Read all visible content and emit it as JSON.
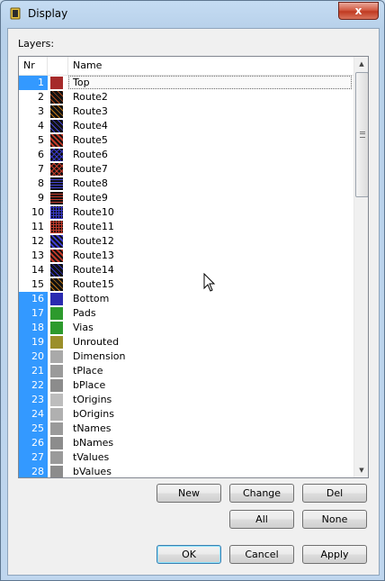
{
  "window": {
    "title": "Display",
    "close_glyph": "x"
  },
  "layers_label": "Layers:",
  "columns": {
    "nr": "Nr",
    "name": "Name"
  },
  "rows": [
    {
      "nr": "1",
      "name": "Top",
      "selected": false,
      "color": "#a62b2b",
      "pattern": "solid"
    },
    {
      "nr": "2",
      "name": "Route2",
      "selected": false,
      "color": "#b04a1b",
      "pattern": "diag-dark"
    },
    {
      "nr": "3",
      "name": "Route3",
      "selected": false,
      "color": "#c07818",
      "pattern": "diag-dark"
    },
    {
      "nr": "4",
      "name": "Route4",
      "selected": false,
      "color": "#4848d8",
      "pattern": "diag-dark"
    },
    {
      "nr": "5",
      "name": "Route5",
      "selected": false,
      "color": "#c23a2a",
      "pattern": "diag-dense"
    },
    {
      "nr": "6",
      "name": "Route6",
      "selected": false,
      "color": "#3838c8",
      "pattern": "cross"
    },
    {
      "nr": "7",
      "name": "Route7",
      "selected": false,
      "color": "#c23a2a",
      "pattern": "cross"
    },
    {
      "nr": "8",
      "name": "Route8",
      "selected": false,
      "color": "#4646d8",
      "pattern": "horiz"
    },
    {
      "nr": "9",
      "name": "Route9",
      "selected": false,
      "color": "#c23a2a",
      "pattern": "horiz"
    },
    {
      "nr": "10",
      "name": "Route10",
      "selected": false,
      "color": "#3838c8",
      "pattern": "grid"
    },
    {
      "nr": "11",
      "name": "Route11",
      "selected": false,
      "color": "#c23a2a",
      "pattern": "grid"
    },
    {
      "nr": "12",
      "name": "Route12",
      "selected": false,
      "color": "#3e3ed0",
      "pattern": "diag-dense"
    },
    {
      "nr": "13",
      "name": "Route13",
      "selected": false,
      "color": "#c23a2a",
      "pattern": "diag-dense"
    },
    {
      "nr": "14",
      "name": "Route14",
      "selected": false,
      "color": "#3838c8",
      "pattern": "diag-dark"
    },
    {
      "nr": "15",
      "name": "Route15",
      "selected": false,
      "color": "#c07818",
      "pattern": "diag-dark"
    },
    {
      "nr": "16",
      "name": "Bottom",
      "selected": true,
      "color": "#2b2bb0",
      "pattern": "solid"
    },
    {
      "nr": "17",
      "name": "Pads",
      "selected": true,
      "color": "#2d9a2d",
      "pattern": "solid"
    },
    {
      "nr": "18",
      "name": "Vias",
      "selected": true,
      "color": "#2d9a2d",
      "pattern": "solid"
    },
    {
      "nr": "19",
      "name": "Unrouted",
      "selected": true,
      "color": "#9b8f2a",
      "pattern": "solid"
    },
    {
      "nr": "20",
      "name": "Dimension",
      "selected": true,
      "color": "#a9a9a9",
      "pattern": "solid"
    },
    {
      "nr": "21",
      "name": "tPlace",
      "selected": true,
      "color": "#9a9a9a",
      "pattern": "solid"
    },
    {
      "nr": "22",
      "name": "bPlace",
      "selected": true,
      "color": "#8c8c8c",
      "pattern": "solid"
    },
    {
      "nr": "23",
      "name": "tOrigins",
      "selected": true,
      "color": "#bdbdbd",
      "pattern": "solid"
    },
    {
      "nr": "24",
      "name": "bOrigins",
      "selected": true,
      "color": "#b0b0b0",
      "pattern": "solid"
    },
    {
      "nr": "25",
      "name": "tNames",
      "selected": true,
      "color": "#9a9a9a",
      "pattern": "solid"
    },
    {
      "nr": "26",
      "name": "bNames",
      "selected": true,
      "color": "#8c8c8c",
      "pattern": "solid"
    },
    {
      "nr": "27",
      "name": "tValues",
      "selected": true,
      "color": "#9a9a9a",
      "pattern": "solid"
    },
    {
      "nr": "28",
      "name": "bValues",
      "selected": true,
      "color": "#8c8c8c",
      "pattern": "solid"
    }
  ],
  "buttons": {
    "new": "New",
    "change": "Change",
    "del": "Del",
    "all": "All",
    "none": "None",
    "ok": "OK",
    "cancel": "Cancel",
    "apply": "Apply"
  },
  "colors": {
    "selection": "#3399ff",
    "accent_border": "#3c7fb1"
  }
}
